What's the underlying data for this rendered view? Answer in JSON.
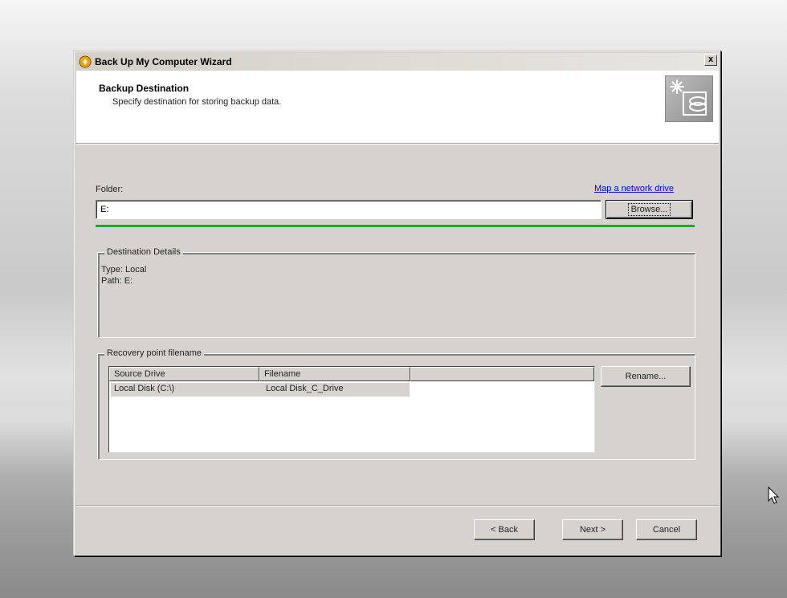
{
  "window": {
    "title": "Back Up My Computer Wizard",
    "close_label": "x"
  },
  "header": {
    "title": "Backup Destination",
    "subtitle": "Specify destination for storing backup data."
  },
  "folder": {
    "label": "Folder:",
    "value": "E:",
    "map_link": "Map a network drive",
    "browse_label": "Browse..."
  },
  "destination_details": {
    "legend": "Destination Details",
    "type_line": "Type: Local",
    "path_line": "Path: E:"
  },
  "recovery": {
    "legend": "Recovery point filename",
    "columns": [
      "Source Drive",
      "Filename",
      ""
    ],
    "rows": [
      {
        "source_drive": "Local Disk (C:\\)",
        "filename": "Local Disk_C_Drive"
      }
    ],
    "rename_label": "Rename..."
  },
  "footer": {
    "back_label": "< Back",
    "next_label": "Next >",
    "cancel_label": "Cancel"
  },
  "colors": {
    "progress_line": "#21a33a",
    "link": "#0000ee",
    "dialog_bg": "#d6d3ce"
  },
  "icons": [
    "wizard-app-icon",
    "backup-destination-icon",
    "close-icon",
    "mouse-cursor-icon"
  ]
}
